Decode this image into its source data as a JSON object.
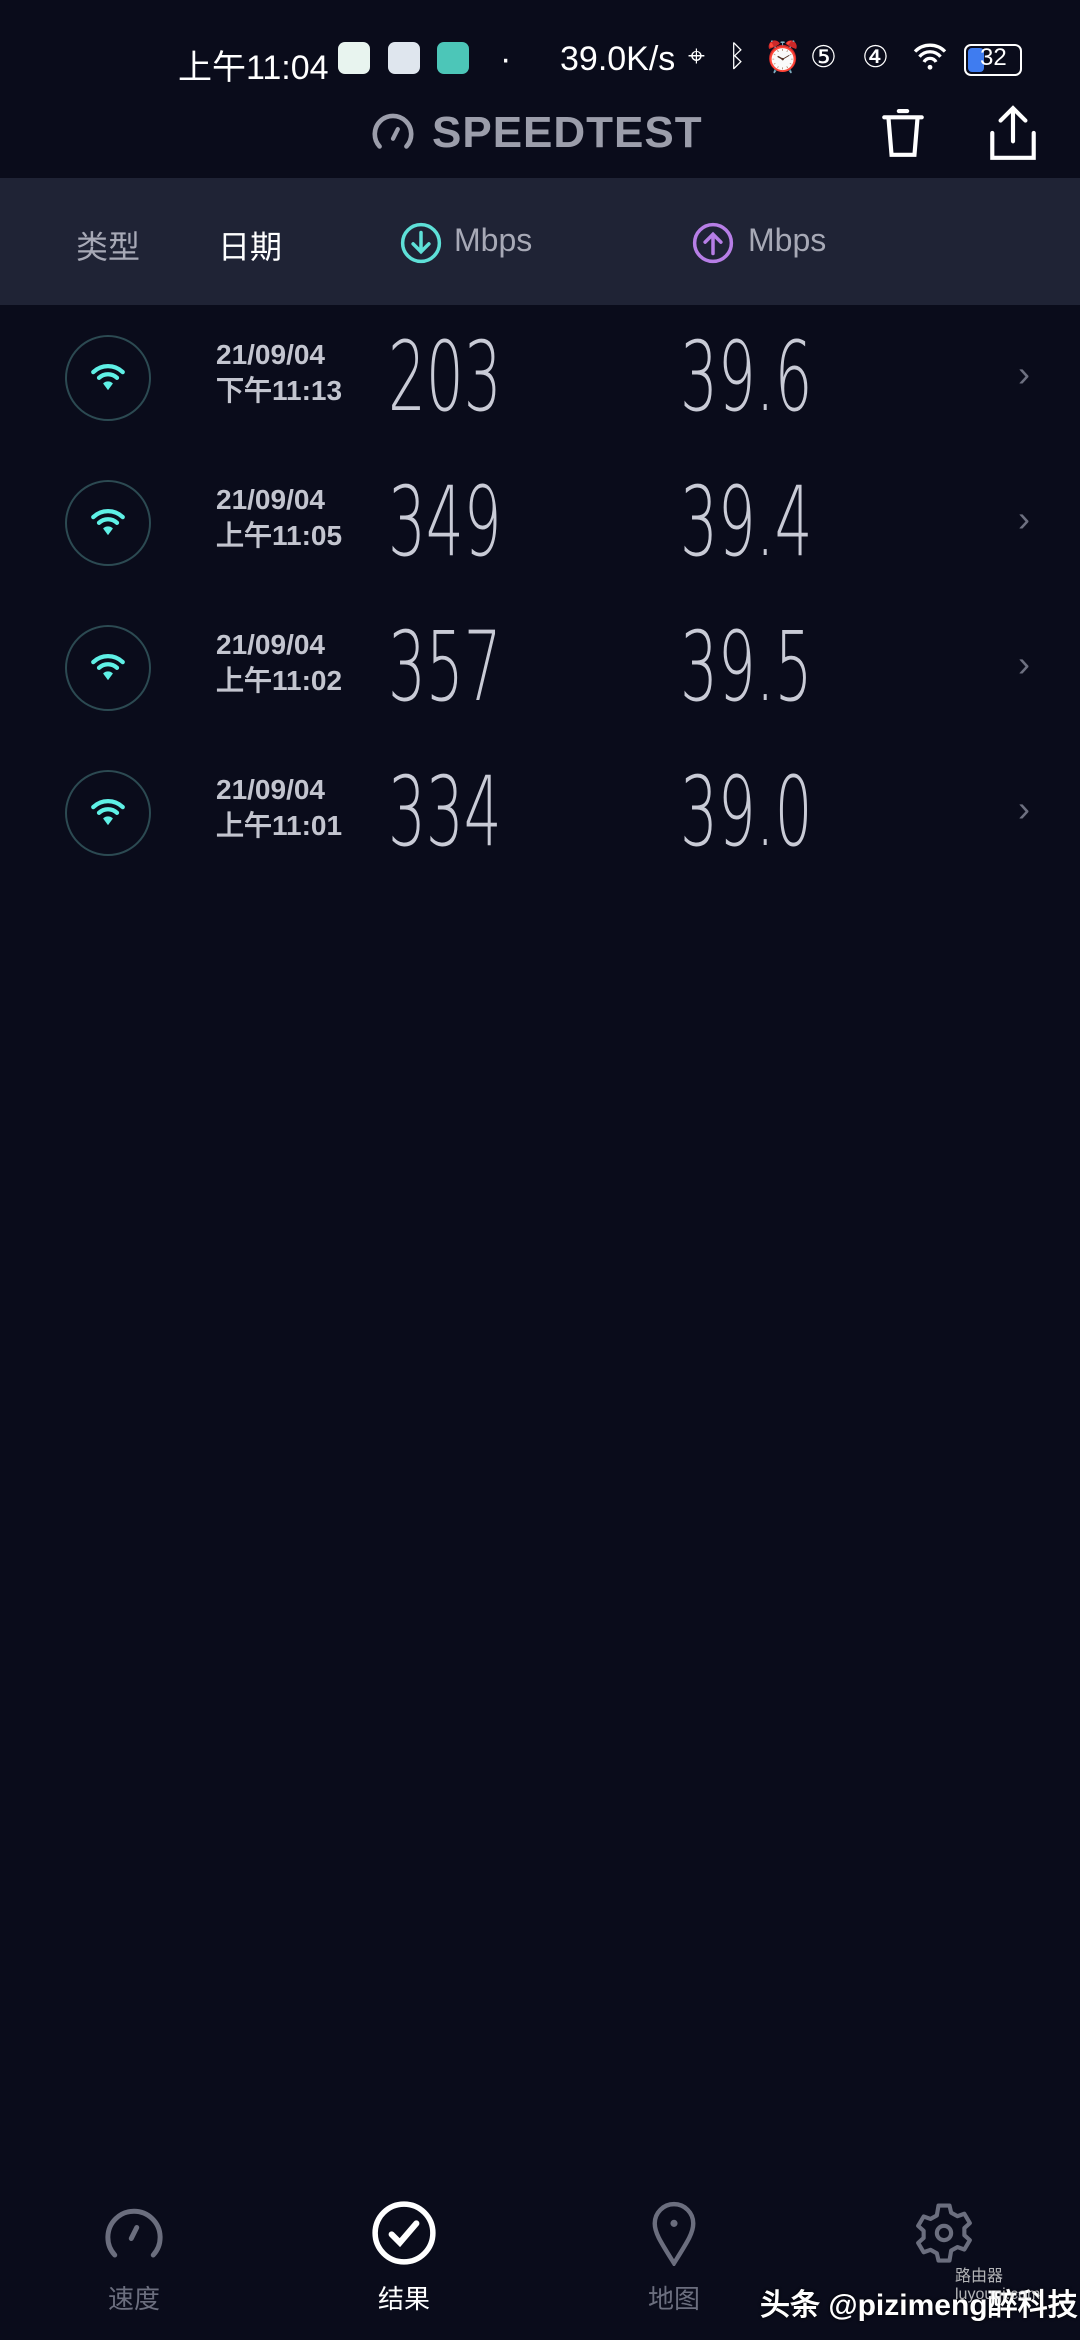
{
  "status_bar": {
    "time": "上午11:04",
    "net_speed": "39.0K/s",
    "battery": "32",
    "dot": "·"
  },
  "header": {
    "title": "SPEEDTEST",
    "icons": [
      "speedometer-icon",
      "trash-icon",
      "share-icon"
    ]
  },
  "columns": {
    "type": "类型",
    "date": "日期",
    "download": "Mbps",
    "upload": "Mbps"
  },
  "colors": {
    "download": "#5ee0d8",
    "upload": "#b77ee6",
    "background": "#0a0c1b",
    "column_bar": "#1f2335",
    "wifi": "#5ff0e6"
  },
  "results": [
    {
      "date": "21/09/04",
      "time": "下午11:13",
      "download": "203",
      "upload": "39.6"
    },
    {
      "date": "21/09/04",
      "time": "上午11:05",
      "download": "349",
      "upload": "39.4"
    },
    {
      "date": "21/09/04",
      "time": "上午11:02",
      "download": "357",
      "upload": "39.5"
    },
    {
      "date": "21/09/04",
      "time": "上午11:01",
      "download": "334",
      "upload": "39.0"
    }
  ],
  "nav": [
    {
      "label": "速度",
      "icon": "speedometer-icon",
      "active": false
    },
    {
      "label": "结果",
      "icon": "check-circle-icon",
      "active": true
    },
    {
      "label": "地图",
      "icon": "map-pin-icon",
      "active": false
    },
    {
      "label": "设置",
      "icon": "gear-icon",
      "active": false
    }
  ],
  "watermark": {
    "text": "头条 @pizimeng醉科技",
    "logo_text": "路由器 luyouqi.com"
  }
}
